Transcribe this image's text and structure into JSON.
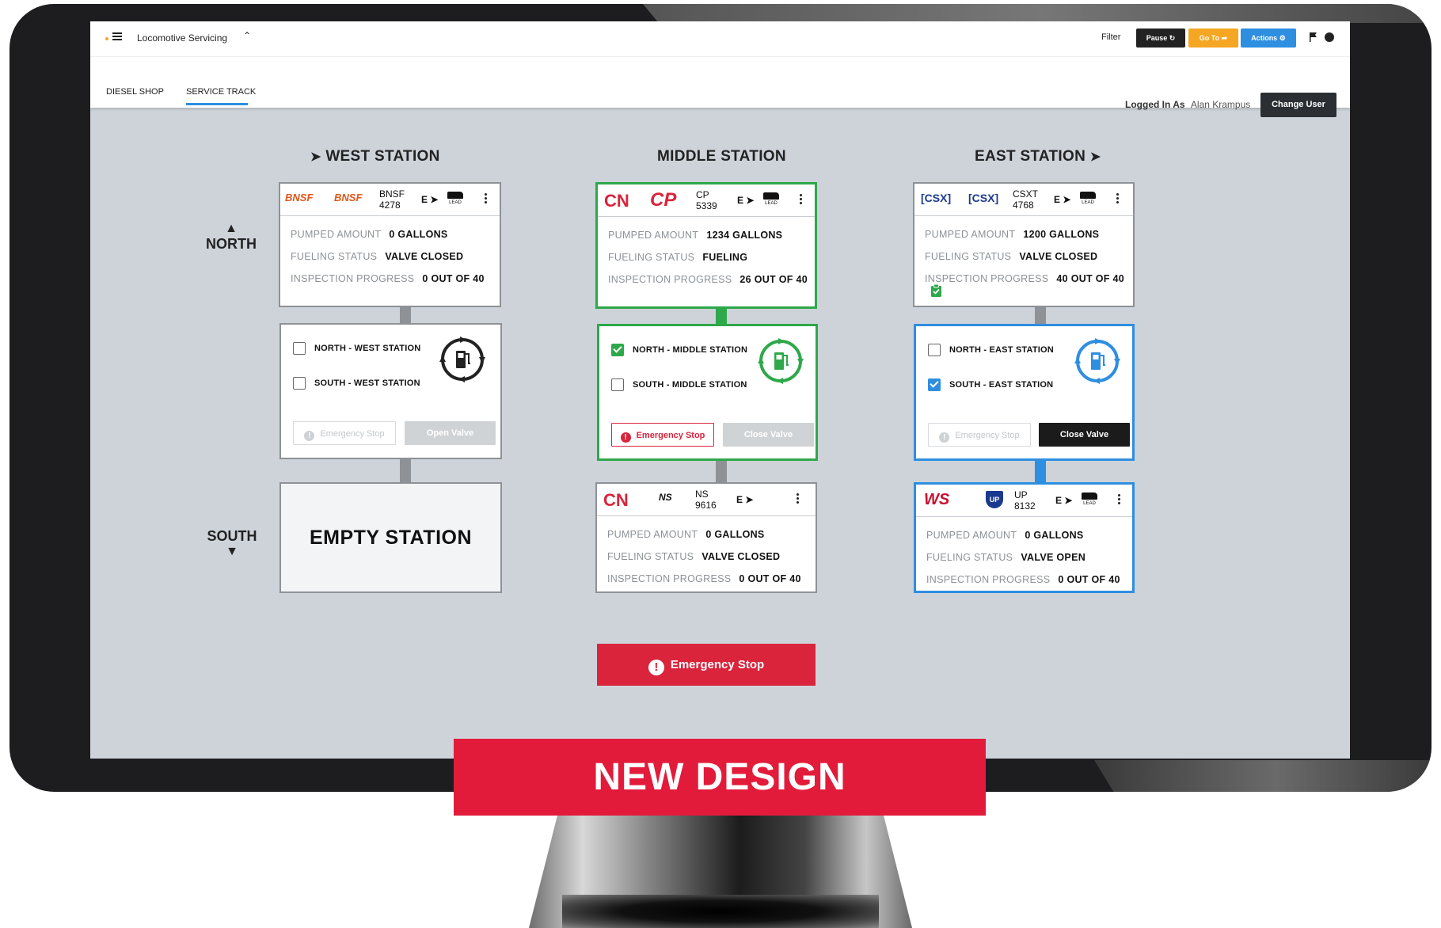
{
  "app": {
    "title": "Locomotive Servicing",
    "toolbar": {
      "filter_label": "Filter",
      "pause_label": "Pause",
      "goto_label": "Go To",
      "actions_label": "Actions"
    },
    "tabs": [
      {
        "label": "DIESEL SHOP",
        "active": false
      },
      {
        "label": "SERVICE TRACK",
        "active": true
      }
    ],
    "session": {
      "logged_in_label": "Logged In As",
      "user_name": "Alan Krampus",
      "change_user_label": "Change User"
    }
  },
  "directions": {
    "north": "NORTH",
    "south": "SOUTH"
  },
  "stations": {
    "west": {
      "title": "WEST STATION",
      "north_loco": {
        "railroad_logos": [
          "BNSF",
          "BNSF"
        ],
        "road": "BNSF",
        "number": "4278",
        "direction": "E",
        "lead_label": "LEAD",
        "pumped_label": "PUMPED AMOUNT",
        "pumped_value": "0 GALLONS",
        "fueling_label": "FUELING STATUS",
        "fueling_value": "VALVE CLOSED",
        "inspection_label": "INSPECTION PROGRESS",
        "inspection_value": "0 OUT OF 40"
      },
      "control": {
        "north_option": "NORTH - WEST STATION",
        "north_checked": false,
        "south_option": "SOUTH - WEST STATION",
        "south_checked": false,
        "emergency_label": "Emergency Stop",
        "emergency_enabled": false,
        "valve_label": "Open Valve",
        "valve_enabled": false,
        "pump_icon": "fuel-pump-cycle-icon"
      },
      "south": {
        "empty_label": "EMPTY STATION"
      }
    },
    "middle": {
      "title": "MIDDLE STATION",
      "north_loco": {
        "railroad_logos": [
          "CN",
          "CP"
        ],
        "road": "CP",
        "number": "5339",
        "direction": "E",
        "lead_label": "LEAD",
        "pumped_label": "PUMPED AMOUNT",
        "pumped_value": "1234 GALLONS",
        "fueling_label": "FUELING STATUS",
        "fueling_value": "FUELING",
        "inspection_label": "INSPECTION PROGRESS",
        "inspection_value": "26 OUT OF 40"
      },
      "control": {
        "north_option": "NORTH - MIDDLE STATION",
        "north_checked": true,
        "south_option": "SOUTH - MIDDLE STATION",
        "south_checked": false,
        "emergency_label": "Emergency Stop",
        "emergency_enabled": true,
        "valve_label": "Close Valve",
        "valve_enabled": false,
        "pump_icon": "fuel-pump-cycle-icon"
      },
      "south_loco": {
        "railroad_logos": [
          "CN",
          "NS"
        ],
        "road": "NS",
        "number": "9616",
        "direction": "E",
        "pumped_label": "PUMPED AMOUNT",
        "pumped_value": "0 GALLONS",
        "fueling_label": "FUELING STATUS",
        "fueling_value": "VALVE CLOSED",
        "inspection_label": "INSPECTION PROGRESS",
        "inspection_value": "0 OUT OF 40"
      }
    },
    "east": {
      "title": "EAST STATION",
      "north_loco": {
        "railroad_logos": [
          "CSX",
          "CSX"
        ],
        "road": "CSXT",
        "number": "4768",
        "direction": "E",
        "lead_label": "LEAD",
        "pumped_label": "PUMPED AMOUNT",
        "pumped_value": "1200 GALLONS",
        "fueling_label": "FUELING STATUS",
        "fueling_value": "VALVE CLOSED",
        "inspection_label": "INSPECTION PROGRESS",
        "inspection_value": "40 OUT OF 40",
        "inspection_complete_icon": "clipboard-check-icon"
      },
      "control": {
        "north_option": "NORTH - EAST STATION",
        "north_checked": false,
        "south_option": "SOUTH - EAST STATION",
        "south_checked": true,
        "emergency_label": "Emergency Stop",
        "emergency_enabled": false,
        "valve_label": "Close Valve",
        "valve_enabled": true,
        "pump_icon": "fuel-pump-cycle-icon"
      },
      "south_loco": {
        "railroad_logos": [
          "WS",
          "UP"
        ],
        "road": "UP",
        "number": "8132",
        "direction": "E",
        "lead_label": "LEAD",
        "pumped_label": "PUMPED AMOUNT",
        "pumped_value": "0 GALLONS",
        "fueling_label": "FUELING STATUS",
        "fueling_value": "VALVE OPEN",
        "inspection_label": "INSPECTION PROGRESS",
        "inspection_value": "0 OUT OF 40"
      }
    }
  },
  "global_emergency_label": "Emergency Stop",
  "banner_label": "NEW DESIGN",
  "colors": {
    "accent_blue": "#2e8ee0",
    "accent_green": "#2ea84a",
    "danger_red": "#d9243c",
    "goto_orange": "#f5a623",
    "banner_red": "#e31b3b"
  }
}
